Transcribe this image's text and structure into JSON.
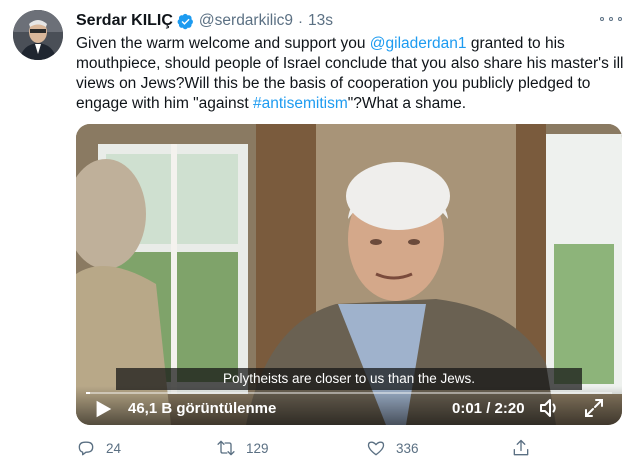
{
  "tweet": {
    "display_name": "Serdar KILIÇ",
    "handle": "@serdarkilic9",
    "separator": "·",
    "time": "13s",
    "verified": true,
    "text_parts": [
      "Given the warm welcome and support you ",
      "@giladerdan1",
      " granted to his mouthpiece, should people of Israel conclude that you also share his master's ill views on Jews?Will this be the basis of cooperation you publicly pledged to engage with him \"against ",
      "#antisemitism",
      "\"?What a shame."
    ]
  },
  "video": {
    "subtitle": "Polytheists are closer to us than the Jews.",
    "views": "46,1 B görüntülenme",
    "timecode": "0:01 / 2:20",
    "progress": 0.007
  },
  "actions": {
    "reply_count": "24",
    "retweet_count": "129",
    "like_count": "336"
  },
  "colors": {
    "link": "#1d9bf0",
    "muted": "#5b7083",
    "verified": "#1d9bf0"
  },
  "icons": [
    "verified-badge-icon",
    "more-icon",
    "play-icon",
    "volume-icon",
    "fullscreen-icon",
    "reply-icon",
    "retweet-icon",
    "like-icon",
    "share-icon"
  ]
}
